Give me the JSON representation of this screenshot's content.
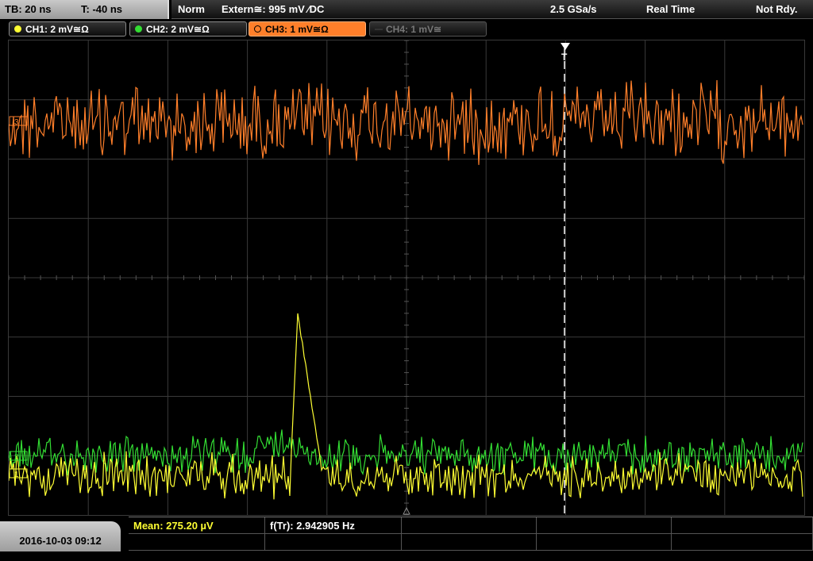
{
  "header": {
    "timebase": "TB: 20 ns",
    "trigger_offset": "T: -40 ns",
    "trigger_mode": "Norm",
    "trigger_source": "Extern≅: 995 mV ⁄DC",
    "sample_rate": "2.5 GSa/s",
    "acquisition_mode": "Real Time",
    "run_state": "Not Rdy."
  },
  "channels": [
    {
      "label": "CH1: 2 mV≅Ω",
      "color": "#ffff33",
      "state": "on"
    },
    {
      "label": "CH2: 2 mV≅Ω",
      "color": "#33dd33",
      "state": "on"
    },
    {
      "label": "CH3: 1 mV≅Ω",
      "color": "#ff7f2a",
      "state": "selected"
    },
    {
      "label": "CH4: 1 mV≅",
      "color": "#777777",
      "state": "off"
    }
  ],
  "screen": {
    "trigger_marker": "T",
    "ch3_marker": "3",
    "ch2_marker": "2",
    "ch1_marker": "1"
  },
  "footer": {
    "datetime": "2016-10-03 09:12",
    "measurement_1": "Mean: 275.20 µV",
    "measurement_2": "f(Tr): 2.942905 Hz"
  },
  "colors": {
    "ch1": "#ffff33",
    "ch2": "#33dd33",
    "ch3": "#ff7f2a",
    "grid": "#3c3c3c",
    "trigger_line": "#ffffff"
  }
}
